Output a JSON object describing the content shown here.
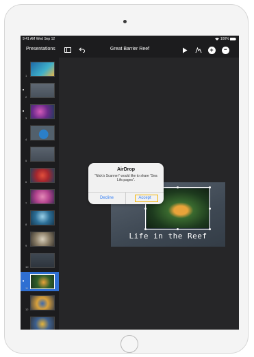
{
  "status_bar": {
    "left": "9:41 AM  Wed Sep 12",
    "right": "100%"
  },
  "toolbar": {
    "back_label": "Presentations",
    "document_title": "Great Barrier Reef",
    "icons": [
      "sidebar-icon",
      "undo-icon",
      "play-icon",
      "annotate-icon",
      "add-icon",
      "more-icon"
    ],
    "add_symbol": "+",
    "more_symbol": "•••"
  },
  "navigator": {
    "selected_index": 10,
    "slides": [
      {
        "num": "1"
      },
      {
        "num": "2"
      },
      {
        "num": "3"
      },
      {
        "num": "4"
      },
      {
        "num": "5"
      },
      {
        "num": "6"
      },
      {
        "num": "7"
      },
      {
        "num": "8"
      },
      {
        "num": "9"
      },
      {
        "num": "10"
      },
      {
        "num": "11"
      },
      {
        "num": "12"
      },
      {
        "num": "13"
      },
      {
        "num": "14"
      }
    ],
    "add_symbol": "+"
  },
  "slide": {
    "title": "Life in the Reef"
  },
  "alert": {
    "title": "AirDrop",
    "message": "“Nick’s Scanner” would like to share “Sea Life.pages”.",
    "decline_label": "Decline",
    "accept_label": "Accept"
  },
  "colors": {
    "accent": "#2f7cf6",
    "selection": "#2f6fd2",
    "highlight": "#f3b400",
    "screen_bg": "#1c1c1e"
  }
}
